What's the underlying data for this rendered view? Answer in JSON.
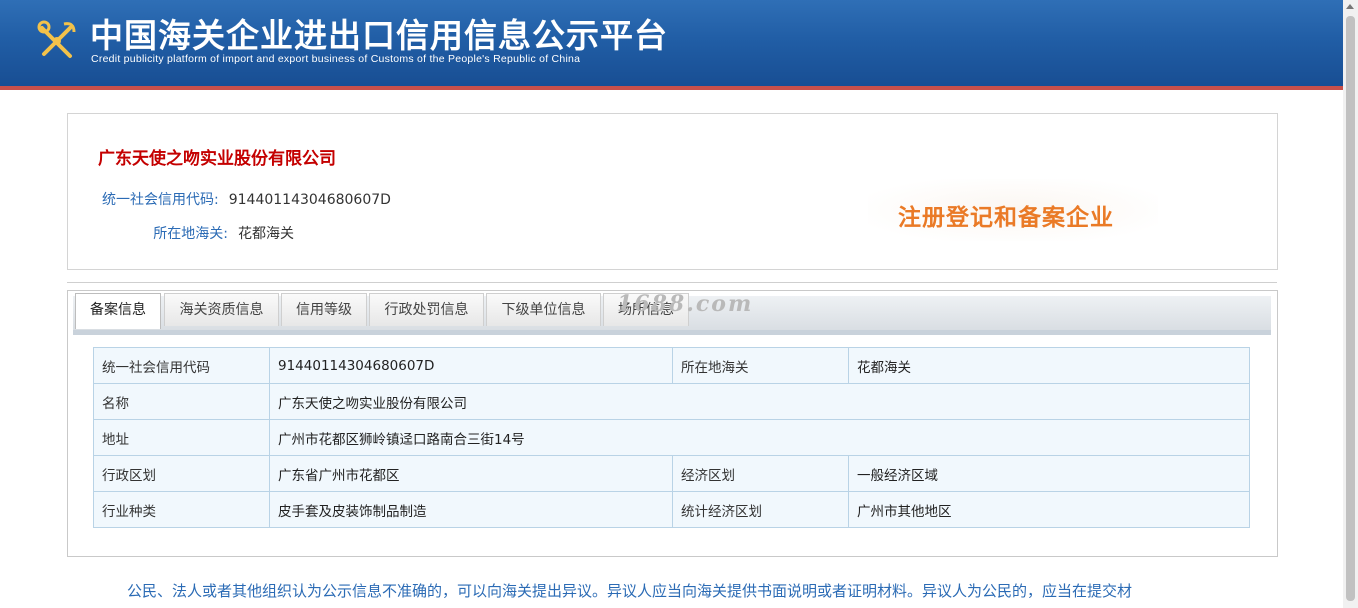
{
  "header": {
    "title": "中国海关企业进出口信用信息公示平台",
    "subtitle": "Credit publicity platform of import and export business of Customs of the People's Republic of China"
  },
  "company": {
    "name": "广东天使之吻实业股份有限公司",
    "credit_code_label": "统一社会信用代码:",
    "credit_code": "91440114304680607D",
    "customs_label": "所在地海关:",
    "customs": "花都海关",
    "stamp": "注册登记和备案企业"
  },
  "watermark": "1688.com",
  "tabs": [
    {
      "label": "备案信息",
      "active": true
    },
    {
      "label": "海关资质信息",
      "active": false
    },
    {
      "label": "信用等级",
      "active": false
    },
    {
      "label": "行政处罚信息",
      "active": false
    },
    {
      "label": "下级单位信息",
      "active": false
    },
    {
      "label": "场所信息",
      "active": false
    }
  ],
  "table": {
    "rows": [
      [
        "统一社会信用代码",
        "91440114304680607D",
        "所在地海关",
        "花都海关"
      ],
      [
        "名称",
        "广东天使之吻实业股份有限公司"
      ],
      [
        "地址",
        "广州市花都区狮岭镇迳口路南合三街14号"
      ],
      [
        "行政区划",
        "广东省广州市花都区",
        "经济区划",
        "一般经济区域"
      ],
      [
        "行业种类",
        "皮手套及皮装饰制品制造",
        "统计经济区划",
        "广州市其他地区"
      ]
    ]
  },
  "footer": {
    "note": "公民、法人或者其他组织认为公示信息不准确的，可以向海关提出异议。异议人应当向海关提供书面说明或者证明材料。异议人为公民的，应当在提交材"
  },
  "colors": {
    "header_blue": "#215ea6",
    "header_accent": "#c8504a",
    "company_red": "#c40000",
    "label_blue": "#2b6bb5",
    "stamp_orange": "#ea7a26"
  }
}
